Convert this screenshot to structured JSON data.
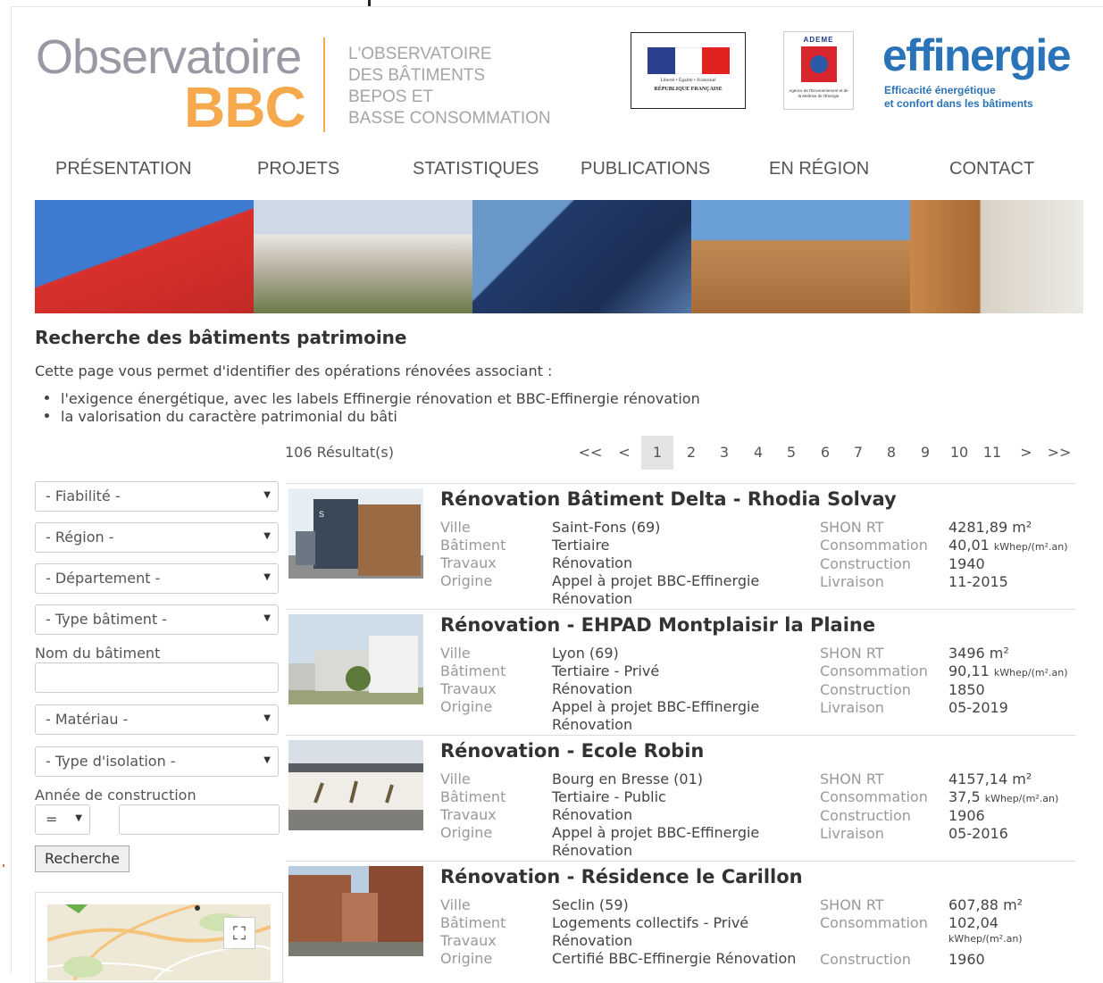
{
  "header": {
    "logo_line1": "Observatoire",
    "logo_line2": "BBC",
    "tagline": [
      "L'OBSERVATOIRE",
      "DES BÂTIMENTS",
      "BEPOS ET",
      "BASSE CONSOMMATION"
    ],
    "republique_motto": "Liberté • Égalité • Fraternité",
    "republique_name": "RÉPUBLIQUE FRANÇAISE",
    "ademe_label": "ADEME",
    "ademe_caption": "Agence de l'Environnement et de la Maîtrise de l'Énergie",
    "effinergie_name": "effinergie",
    "effinergie_sub1": "Efficacité énergétique",
    "effinergie_sub2": "et confort dans les bâtiments"
  },
  "nav": [
    "PRÉSENTATION",
    "PROJETS",
    "STATISTIQUES",
    "PUBLICATIONS",
    "EN RÉGION",
    "CONTACT"
  ],
  "page": {
    "title": "Recherche des bâtiments patrimoine",
    "intro": "Cette page vous permet d'identifier des opérations rénovées associant :",
    "bullets": [
      "l'exigence énergétique, avec les labels Effinergie rénovation et BBC-Effinergie rénovation",
      "la valorisation du caractère patrimonial du bâti"
    ],
    "results_count": "106 Résultat(s)"
  },
  "pager": [
    "<<",
    "<",
    "1",
    "2",
    "3",
    "4",
    "5",
    "6",
    "7",
    "8",
    "9",
    "10",
    "11",
    ">",
    ">>"
  ],
  "pager_current": "1",
  "filters": {
    "fiabilite": "- Fiabilité -",
    "region": "- Région -",
    "departement": "- Département -",
    "type_batiment": "- Type bâtiment -",
    "nom_label": "Nom du bâtiment",
    "nom_value": "",
    "materiau": "- Matériau -",
    "type_isolation": "- Type d'isolation -",
    "annee_label": "Année de construction",
    "annee_operator": "=",
    "annee_value": "",
    "search_button": "Recherche"
  },
  "results": [
    {
      "title": "Rénovation Bâtiment Delta - Rhodia Solvay",
      "labels": [
        "Ville",
        "Bâtiment",
        "Travaux",
        "Origine"
      ],
      "ville": "Saint-Fons (69)",
      "batiment": "Tertiaire",
      "travaux": "Rénovation",
      "origine1": "Appel à projet BBC-Effinergie",
      "origine2": "Rénovation",
      "labels2": [
        "SHON RT",
        "Consommation",
        "Construction",
        "Livraison"
      ],
      "shon": "4281,89 m²",
      "conso": "40,01",
      "conso_unit": "kWhep/(m².an)",
      "construction": "1940",
      "livraison": "11-2015"
    },
    {
      "title": "Rénovation - EHPAD Montplaisir la Plaine",
      "labels": [
        "Ville",
        "Bâtiment",
        "Travaux",
        "Origine"
      ],
      "ville": "Lyon (69)",
      "batiment": "Tertiaire - Privé",
      "travaux": "Rénovation",
      "origine1": "Appel à projet BBC-Effinergie",
      "origine2": "Rénovation",
      "labels2": [
        "SHON RT",
        "Consommation",
        "Construction",
        "Livraison"
      ],
      "shon": "3496 m²",
      "conso": "90,11",
      "conso_unit": "kWhep/(m².an)",
      "construction": "1850",
      "livraison": "05-2019"
    },
    {
      "title": "Rénovation - Ecole Robin",
      "labels": [
        "Ville",
        "Bâtiment",
        "Travaux",
        "Origine"
      ],
      "ville": "Bourg en Bresse (01)",
      "batiment": "Tertiaire - Public",
      "travaux": "Rénovation",
      "origine1": "Appel à projet BBC-Effinergie",
      "origine2": "Rénovation",
      "labels2": [
        "SHON RT",
        "Consommation",
        "Construction",
        "Livraison"
      ],
      "shon": "4157,14 m²",
      "conso": "37,5",
      "conso_unit": "kWhep/(m².an)",
      "construction": "1906",
      "livraison": "05-2016"
    },
    {
      "title": "Rénovation - Résidence le Carillon",
      "labels": [
        "Ville",
        "Bâtiment",
        "Travaux",
        "Origine"
      ],
      "ville": "Seclin (59)",
      "batiment": "Logements collectifs - Privé",
      "travaux": "Rénovation",
      "origine1": "Certifié BBC-Effinergie Rénovation",
      "origine2": "",
      "labels2": [
        "SHON RT",
        "Consommation",
        "",
        "Construction"
      ],
      "shon": "607,88 m²",
      "conso": "102,04",
      "conso_unit": "kWhep/(m².an)",
      "construction": "1960",
      "livraison": ""
    }
  ],
  "colors": {
    "accent_orange": "#f5a94c",
    "logo_grey": "#9a98a3",
    "effinergie_blue": "#2a73b8",
    "pager_current_bg": "#e4e4e4"
  },
  "icons": {
    "fullscreen": "expand-icon",
    "select_arrow": "chevron-down-icon"
  }
}
